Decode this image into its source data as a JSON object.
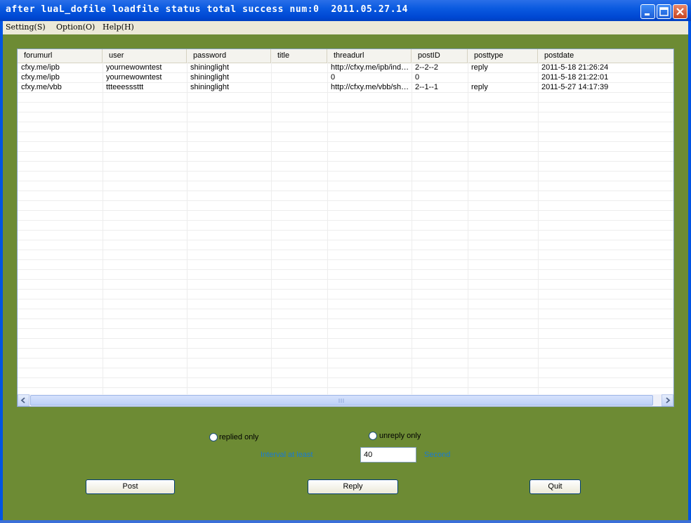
{
  "window": {
    "title": "after luaL_dofile loadfile status total success num:0  2011.05.27.14"
  },
  "menu": [
    {
      "label": "Setting(S)"
    },
    {
      "label": "Option(O)"
    },
    {
      "label": "Help(H)"
    }
  ],
  "table": {
    "columns": [
      "forumurl",
      "user",
      "password",
      "title",
      "threadurl",
      "postID",
      "posttype",
      "postdate"
    ],
    "rows": [
      [
        "cfxy.me/ipb",
        "yournewowntest",
        "shininglight",
        "",
        "http://cfxy.me/ipb/index.php?",
        "2--2--2",
        "reply",
        "2011-5-18 21:26:24"
      ],
      [
        "cfxy.me/ipb",
        "yournewowntest",
        "shininglight",
        "",
        "0",
        "0",
        "",
        "2011-5-18 21:22:01"
      ],
      [
        "cfxy.me/vbb",
        "ttteeesssttt",
        "shininglight",
        "",
        "http://cfxy.me/vbb/showthread.php",
        "2--1--1",
        "reply",
        "2011-5-27 14:17:39"
      ]
    ]
  },
  "filters": {
    "replied_only": "replied only",
    "unreply_only": "unreply only"
  },
  "interval": {
    "label": "Interval at least",
    "value": "40",
    "unit": "Second"
  },
  "buttons": {
    "post": "Post",
    "reply": "Reply",
    "quit": "Quit"
  },
  "colors": {
    "client_background": "#6d8b34",
    "titlebar": "#0a5ae0",
    "label_blue": "#1a7bd0"
  }
}
